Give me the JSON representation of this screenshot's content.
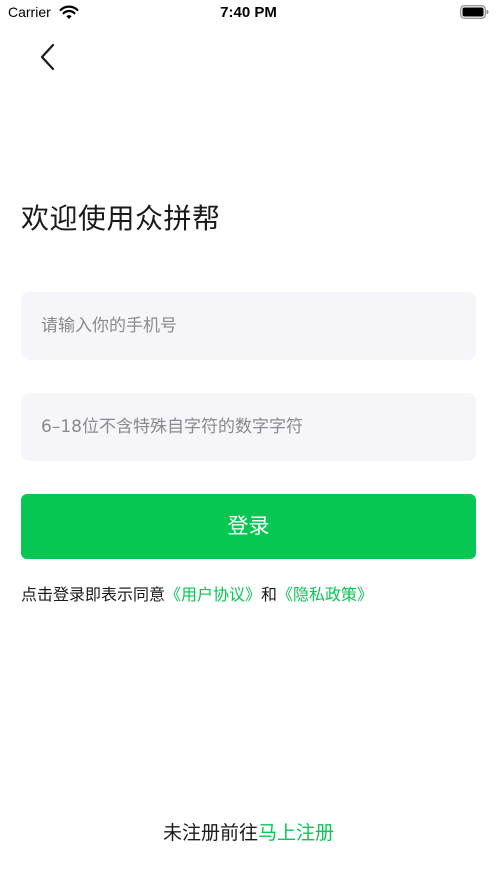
{
  "status_bar": {
    "carrier": "Carrier",
    "time": "7:40 PM",
    "wifi_icon": "wifi-icon",
    "battery_icon": "battery-icon"
  },
  "nav": {
    "back_icon": "chevron-left-icon"
  },
  "main": {
    "title": "欢迎使用众拼帮",
    "phone_input": {
      "value": "",
      "placeholder": "请输入你的手机号"
    },
    "password_input": {
      "value": "",
      "placeholder": "6–18位不含特殊自字符的数字字符"
    },
    "login_label": "登录",
    "agreement": {
      "prefix": "点击登录即表示同意",
      "user_agreement": "《用户协议》",
      "and": "和",
      "privacy_policy": "《隐私政策》"
    }
  },
  "footer": {
    "prefix": "未注册前往",
    "register_link": "马上注册"
  },
  "colors": {
    "accent": "#07c753",
    "input_bg": "#f6f5fa",
    "placeholder": "#8a8a8e"
  }
}
